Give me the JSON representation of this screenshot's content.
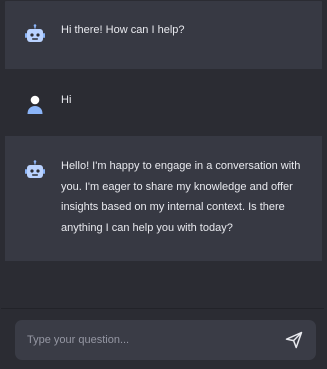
{
  "messages": [
    {
      "role": "bot",
      "avatar_icon": "robot-icon",
      "text": "Hi there! How can I help?"
    },
    {
      "role": "user",
      "avatar_icon": "user-icon",
      "text": "Hi"
    },
    {
      "role": "bot",
      "avatar_icon": "robot-icon",
      "text": "Hello! I'm happy to engage in a conversation with you. I'm eager to share my knowledge and offer insights based on my internal context. Is there anything I can help you with today?"
    }
  ],
  "input": {
    "placeholder": "Type your question...",
    "value": ""
  },
  "send_icon": "send-icon",
  "colors": {
    "background": "#2b2c33",
    "bot_message_bg": "#373943",
    "input_bg": "#3a3c46",
    "text": "#e8e9ee",
    "placeholder": "#9597a3",
    "accent": "#8ab4f8"
  }
}
